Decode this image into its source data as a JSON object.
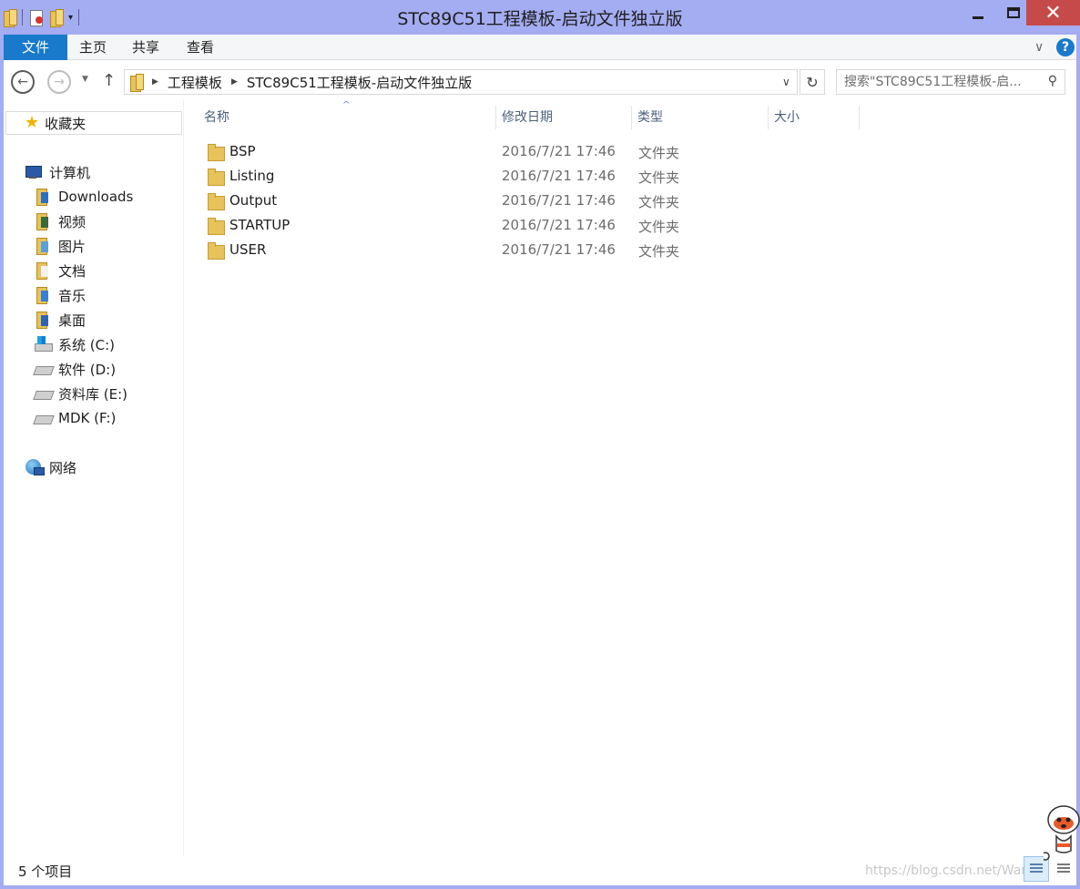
{
  "window": {
    "title": "STC89C51工程模板-启动文件独立版",
    "close_label": "✕"
  },
  "ribbon": {
    "tabs": [
      {
        "label": "文件"
      },
      {
        "label": "主页"
      },
      {
        "label": "共享"
      },
      {
        "label": "查看"
      }
    ],
    "help_label": "?"
  },
  "address": {
    "crumbs": [
      "工程模板",
      "STC89C51工程模板-启动文件独立版"
    ]
  },
  "search": {
    "placeholder": "搜索\"STC89C51工程模板-启..."
  },
  "nav": {
    "favorites": "收藏夹",
    "computer": "计算机",
    "items": [
      {
        "label": "Downloads",
        "icon": "downloads-icon"
      },
      {
        "label": "视频",
        "icon": "videos-icon"
      },
      {
        "label": "图片",
        "icon": "pictures-icon"
      },
      {
        "label": "文档",
        "icon": "documents-icon"
      },
      {
        "label": "音乐",
        "icon": "music-icon"
      },
      {
        "label": "桌面",
        "icon": "desktop-icon"
      },
      {
        "label": "系统 (C:)",
        "icon": "system-drive-icon"
      },
      {
        "label": "软件 (D:)",
        "icon": "drive-icon"
      },
      {
        "label": "资料库 (E:)",
        "icon": "drive-icon"
      },
      {
        "label": "MDK (F:)",
        "icon": "drive-icon"
      }
    ],
    "network": "网络"
  },
  "columns": {
    "name": "名称",
    "modified": "修改日期",
    "type": "类型",
    "size": "大小"
  },
  "files": [
    {
      "name": "BSP",
      "modified": "2016/7/21 17:46",
      "type": "文件夹"
    },
    {
      "name": "Listing",
      "modified": "2016/7/21 17:46",
      "type": "文件夹"
    },
    {
      "name": "Output",
      "modified": "2016/7/21 17:46",
      "type": "文件夹"
    },
    {
      "name": "STARTUP",
      "modified": "2016/7/21 17:46",
      "type": "文件夹"
    },
    {
      "name": "USER",
      "modified": "2016/7/21 17:46",
      "type": "文件夹"
    }
  ],
  "status": {
    "count": "5 个项目",
    "watermark": "https://blog.csdn.net/Wan"
  },
  "colors": {
    "titlebar": "#a4acf2",
    "file_tab": "#1979ca",
    "close": "#c74a4a"
  }
}
